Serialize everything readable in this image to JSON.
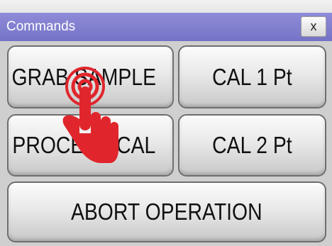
{
  "top_strip": {
    "text": "~~~~ ~~~~ ~~~"
  },
  "dialog": {
    "title": "Commands",
    "close_label": "x"
  },
  "buttons": {
    "grab_sample": "GRAB SAMPLE",
    "cal_1pt": "CAL 1 Pt",
    "process_cal": "PROCESS CAL",
    "cal_2pt": "CAL 2 Pt",
    "abort_operation": "ABORT OPERATION"
  },
  "icons": {
    "touch_hand": "tap-hand-icon"
  },
  "colors": {
    "title_bar": "#8280cf",
    "hand": "#e0262c",
    "panel": "#cfcfcf"
  }
}
